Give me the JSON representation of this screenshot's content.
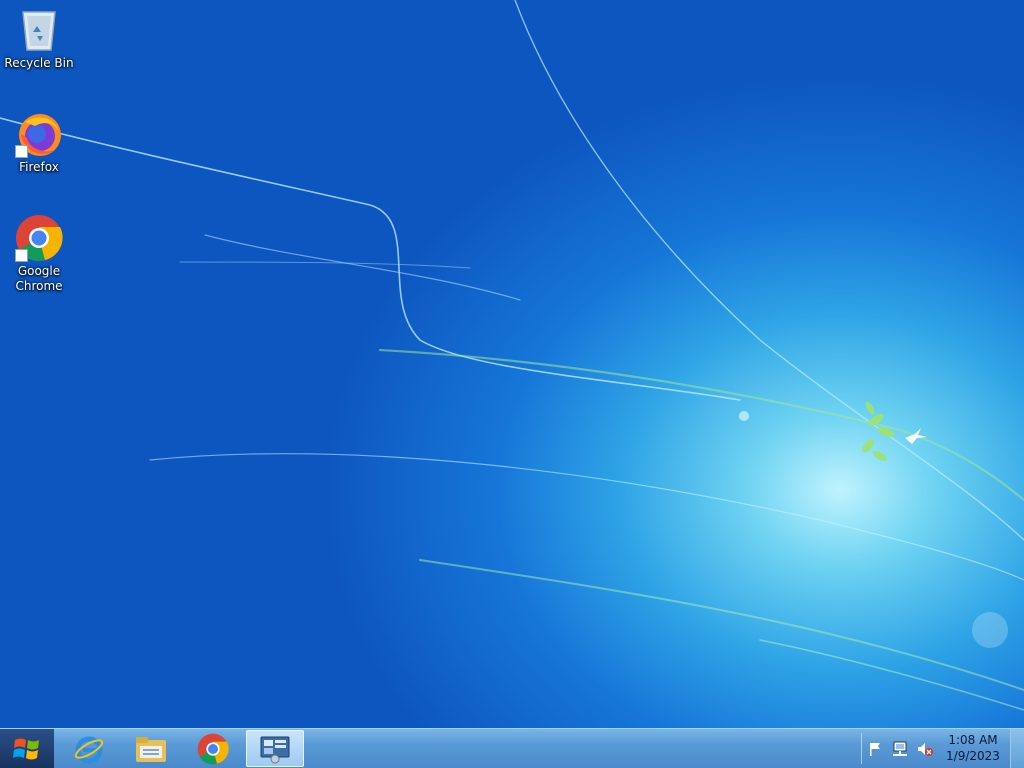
{
  "desktop": {
    "icons": [
      {
        "label": "Recycle Bin",
        "icon": "recycle-bin-icon"
      },
      {
        "label": "Firefox",
        "icon": "firefox-icon"
      },
      {
        "label": "Google Chrome",
        "icon": "chrome-icon"
      }
    ]
  },
  "taskbar": {
    "start": {
      "icon": "windows-logo-icon"
    },
    "pinned": [
      {
        "icon": "internet-explorer-icon"
      },
      {
        "icon": "file-explorer-icon"
      },
      {
        "icon": "chrome-icon"
      },
      {
        "icon": "server-manager-icon",
        "active": true
      }
    ],
    "tray": {
      "icons": [
        "action-center-flag-icon",
        "network-icon",
        "volume-muted-icon"
      ],
      "time": "1:08 AM",
      "date": "1/9/2023"
    }
  },
  "colors": {
    "taskbar": "#5a9ad6",
    "desktop_dark": "#0d55bf",
    "desktop_light": "#bff3ff"
  }
}
